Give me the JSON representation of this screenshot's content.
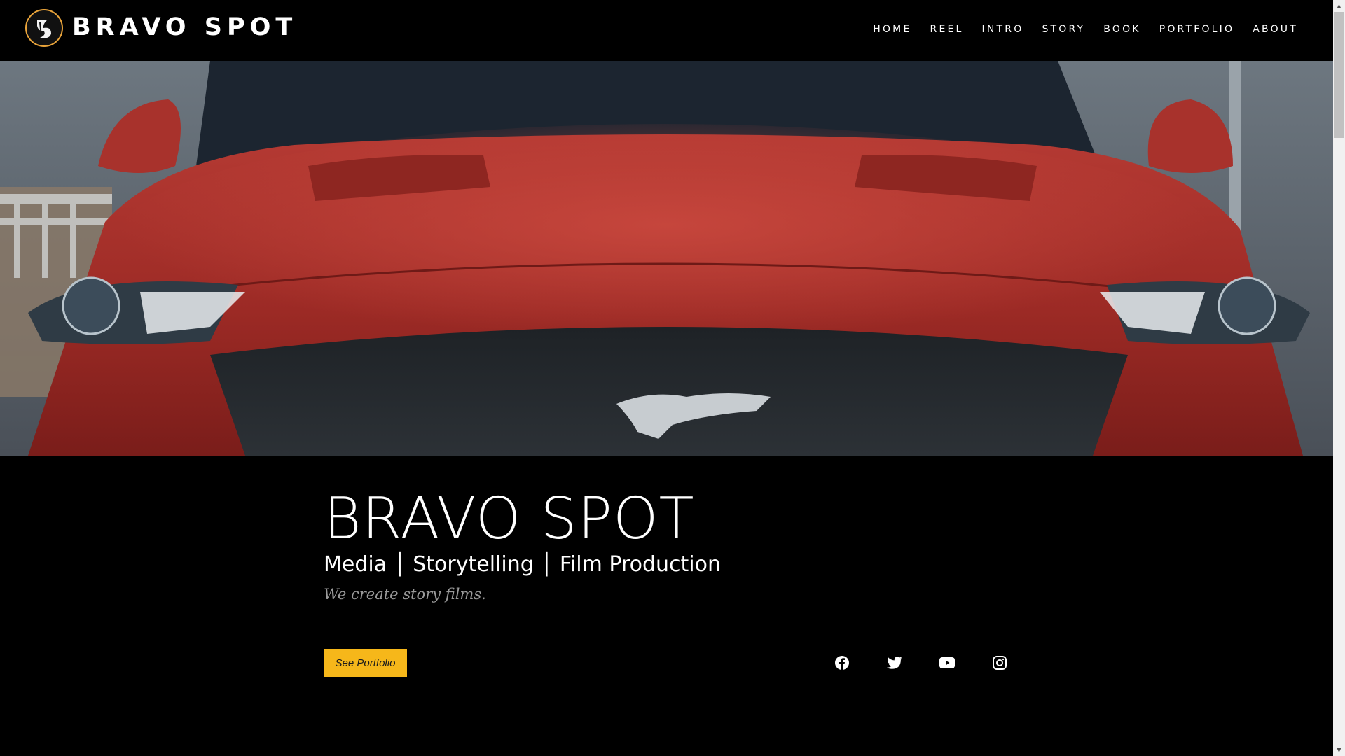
{
  "header": {
    "brand": "BRAVO SPOT",
    "nav": [
      "HOME",
      "REEL",
      "INTRO",
      "STORY",
      "BOOK",
      "PORTFOLIO",
      "ABOUT"
    ]
  },
  "hero": {
    "image": "red-mustang-front-photo"
  },
  "info": {
    "title": "BRAVO SPOT",
    "subtitle": "Media │ Storytelling │ Film Production",
    "tagline": "We create story films.",
    "cta_label": "See Portfolio"
  },
  "social": [
    "facebook-icon",
    "twitter-icon",
    "youtube-icon",
    "instagram-icon"
  ],
  "colors": {
    "background": "#000000",
    "accent": "#f6b71a",
    "logo_ring": "#e8a33a",
    "text": "#ffffff",
    "tagline": "#9a9a9a"
  }
}
